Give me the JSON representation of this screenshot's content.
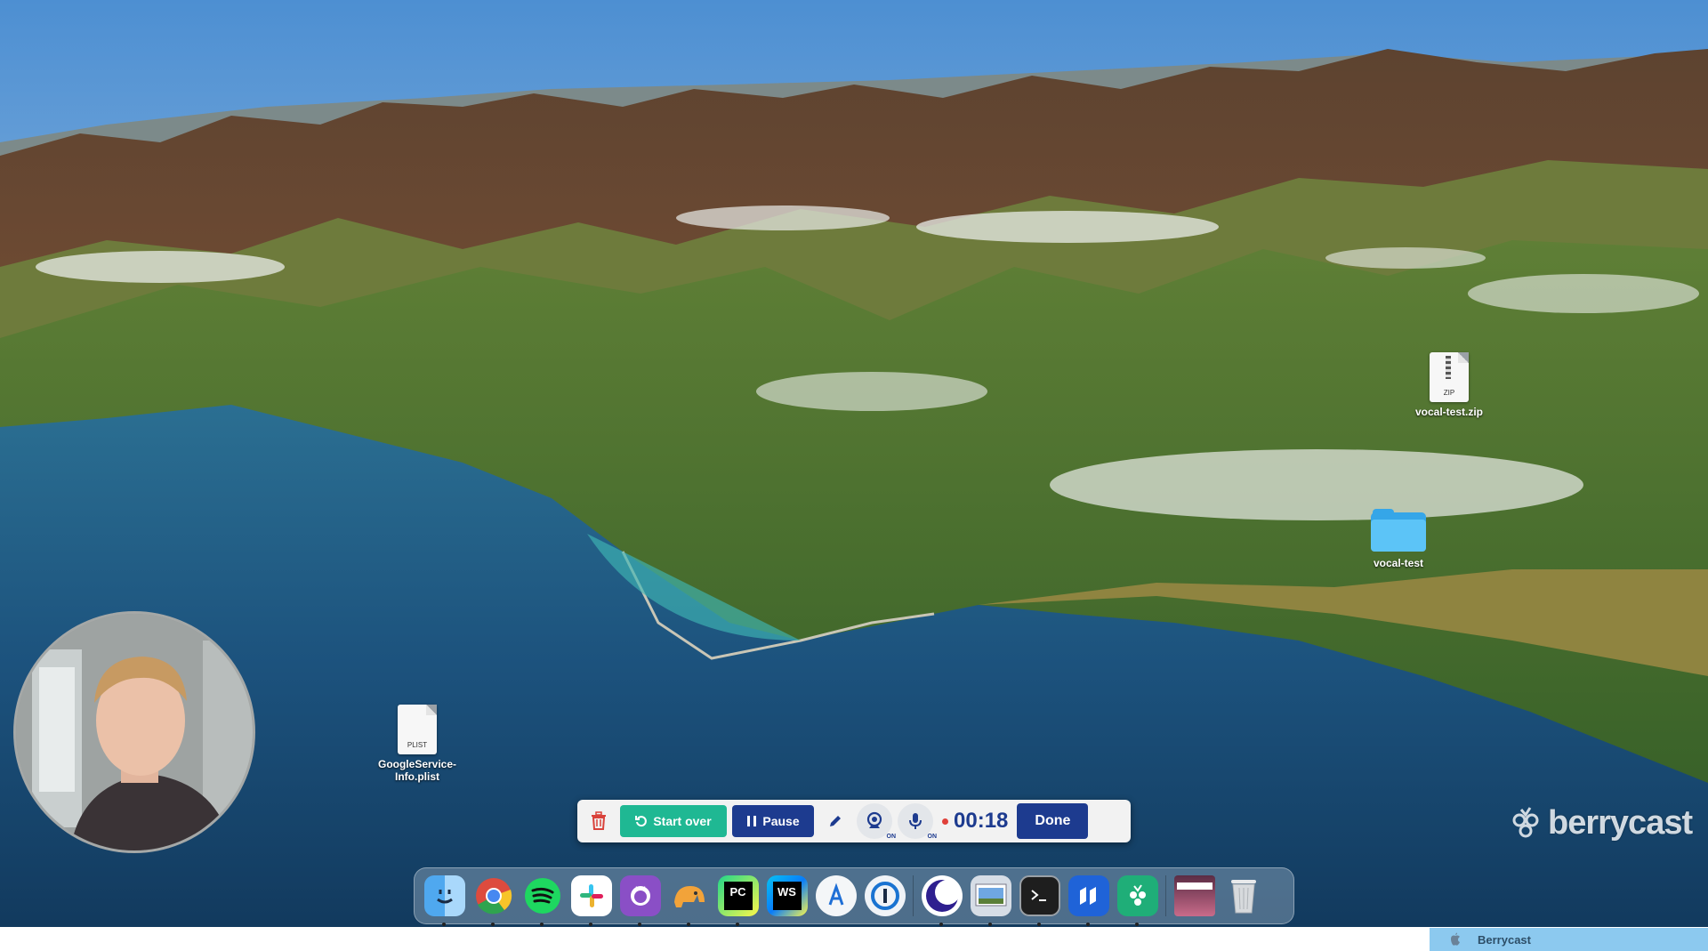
{
  "desktop": {
    "icons": [
      {
        "label": "vocal-test.zip",
        "tag": "ZIP"
      },
      {
        "label": "vocal-test"
      },
      {
        "label_line1": "GoogleService-",
        "label_line2": "Info.plist",
        "tag": "PLIST"
      }
    ]
  },
  "recorder": {
    "trash_icon": "trash-icon",
    "start_over_label": "Start over",
    "pause_label": "Pause",
    "draw_icon": "pencil-icon",
    "camera_toggle": {
      "icon": "webcam-icon",
      "state": "ON"
    },
    "mic_toggle": {
      "icon": "microphone-icon",
      "state": "ON"
    },
    "timer": "00:18",
    "done_label": "Done",
    "colors": {
      "start_over": "#1fb893",
      "primary": "#1d3b8f",
      "record_dot": "#e0413a"
    }
  },
  "dock": {
    "apps": [
      {
        "icon": "finder-icon",
        "running": true
      },
      {
        "icon": "chrome-icon",
        "running": true
      },
      {
        "icon": "spotify-icon",
        "running": true
      },
      {
        "icon": "slack-icon",
        "running": true
      },
      {
        "icon": "github-desktop-icon",
        "running": true
      },
      {
        "icon": "tableplus-elephant-icon",
        "running": true
      },
      {
        "icon": "pycharm-icon",
        "running": true
      },
      {
        "icon": "webstorm-icon",
        "running": false
      },
      {
        "icon": "xcode-instruments-icon",
        "running": false
      },
      {
        "icon": "1password-icon",
        "running": false
      },
      {
        "icon": "night-owl-icon",
        "running": true
      },
      {
        "icon": "preview-icon",
        "running": true
      },
      {
        "icon": "terminal-icon",
        "running": true
      },
      {
        "icon": "kanban-icon",
        "running": true
      },
      {
        "icon": "berrycast-icon",
        "running": true
      },
      {
        "icon": "downloads-stack-icon",
        "running": false
      },
      {
        "icon": "trash-bin-icon",
        "running": false
      }
    ]
  },
  "watermark": {
    "text": "berrycast"
  },
  "app_strip": {
    "apple_icon": "apple-icon",
    "name": "Berrycast"
  }
}
